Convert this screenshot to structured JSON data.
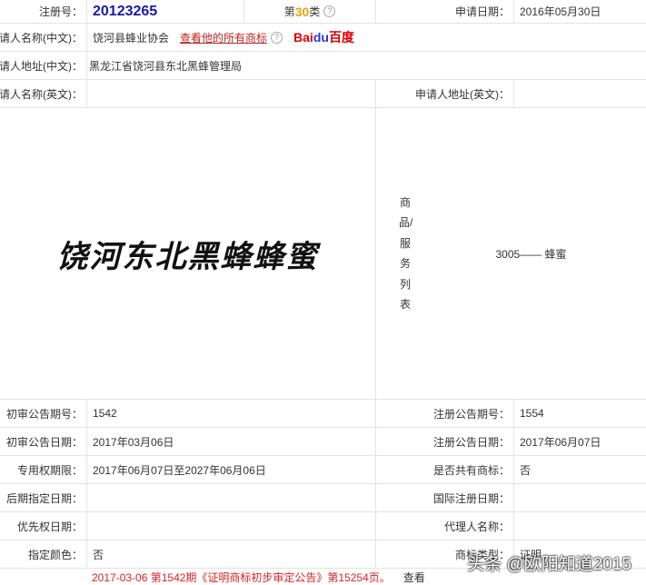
{
  "reg_no_label": "注册号：",
  "reg_no": "20123265",
  "class_prefix": "第",
  "class_num": "30",
  "class_suffix": "类",
  "class_color": "#f0a000",
  "apply_date_label": "申请日期：",
  "apply_date": "2016年05月30日",
  "applicant_cn_label": "请人名称(中文)：",
  "applicant_cn": "饶河县蜂业协会",
  "view_all_link": "查看他的所有商标",
  "baidu_logo": {
    "bai": "Bai",
    "du": "du",
    "cn": "百度"
  },
  "address_cn_label": "请人地址(中文)：",
  "address_cn": "黑龙江省饶河县东北黑蜂管理局",
  "applicant_en_label": "请人名称(英文)：",
  "address_en_label": "申请人地址(英文)：",
  "mark_image_text": "饶河东北黑蜂蜂蜜",
  "goods_label": "商品/服务列表",
  "goods": "3005—— 蜂蜜",
  "rows": [
    {
      "l1": "初审公告期号：",
      "v1": "1542",
      "l2": "注册公告期号：",
      "v2": "1554"
    },
    {
      "l1": "初审公告日期：",
      "v1": "2017年03月06日",
      "l2": "注册公告日期：",
      "v2": "2017年06月07日"
    },
    {
      "l1": "专用权期限：",
      "v1": "2017年06月07日至2027年06月06日",
      "l2": "是否共有商标：",
      "v2": "否"
    },
    {
      "l1": "后期指定日期：",
      "v1": "",
      "l2": "国际注册日期：",
      "v2": ""
    },
    {
      "l1": "优先权日期：",
      "v1": "",
      "l2": "代理人名称：",
      "v2": ""
    },
    {
      "l1": "指定颜色：",
      "v1": "否",
      "l2": "商标类型：",
      "v2": "证明"
    }
  ],
  "notice": "2017-03-06 第1542期《证明商标初步审定公告》第15254页。",
  "notice_view": "查看",
  "watermark": "头条 @欧阳知道2015"
}
